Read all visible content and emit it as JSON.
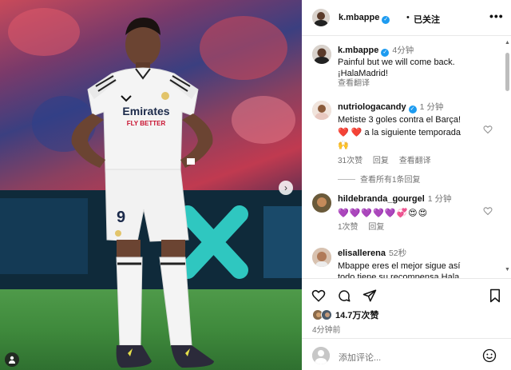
{
  "post": {
    "author": "k.mbappe",
    "follow_dot": "•",
    "follow_state": "已关注",
    "more_label": "•••",
    "caption": {
      "username": "k.mbappe",
      "time": "4分钟",
      "line1": "Painful but we will come back.",
      "line2": "¡HalaMadrid!",
      "translate": "查看翻译"
    },
    "likes": "14.7万次赞",
    "posted": "4分钟前",
    "add_comment_placeholder": "添加评论...",
    "carousel_next": "›",
    "photo": {
      "sponsor": "Emirates",
      "sponsor_sub": "FLY BETTER",
      "number": "9"
    }
  },
  "comments": [
    {
      "username": "nutriologacandy",
      "verified": true,
      "time": "1 分钟",
      "text_line1": "Metiste 3 goles contra el Barça!",
      "text_line2": "❤️ ❤️ a la siguiente temporada",
      "text_line3": "🙌",
      "likes": "31次赞",
      "reply": "回复",
      "translate": "查看翻译",
      "view_replies": "查看所有1条回复"
    },
    {
      "username": "hildebranda_gourgel",
      "time": "1 分钟",
      "text": "💜💜💜💜💜💞😍😍",
      "likes": "1次赞",
      "reply": "回复"
    },
    {
      "username": "elisallerena",
      "time": "52秒",
      "text_line1": "Mbappe eres el mejor sigue así",
      "text_line2": "todo tiene su recompensa Hala"
    }
  ],
  "colors": {
    "verified": "#1d9bf0",
    "muted": "#737373",
    "heart": "#e0245e"
  }
}
